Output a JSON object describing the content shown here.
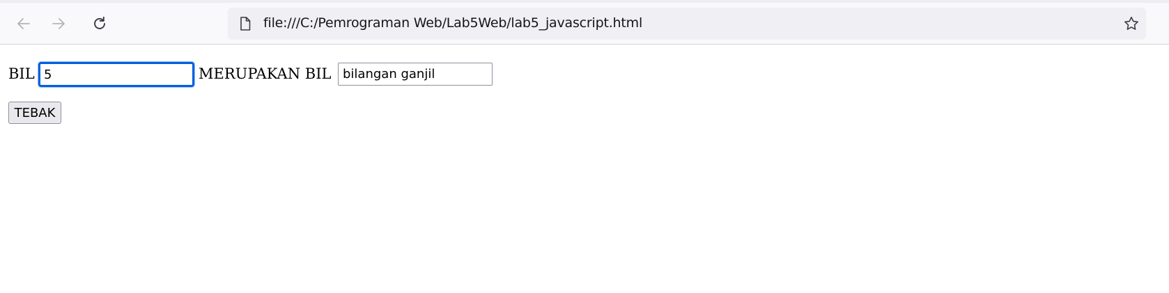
{
  "browser": {
    "url": "file:///C:/Pemrograman Web/Lab5Web/lab5_javascript.html",
    "icons": {
      "back": "arrow-left-icon",
      "forward": "arrow-right-icon",
      "reload": "reload-icon",
      "page": "page-document-icon",
      "bookmark": "star-icon"
    },
    "colors": {
      "toolbar_bg": "#f9f9fb",
      "urlbar_bg": "#f0f0f4",
      "focus_ring": "#0060df"
    }
  },
  "form": {
    "bil_label": "BIL",
    "bil_value": "5",
    "result_label": "MERUPAKAN BIL",
    "result_value": "bilangan ganjil",
    "submit_label": "TEBAK"
  }
}
